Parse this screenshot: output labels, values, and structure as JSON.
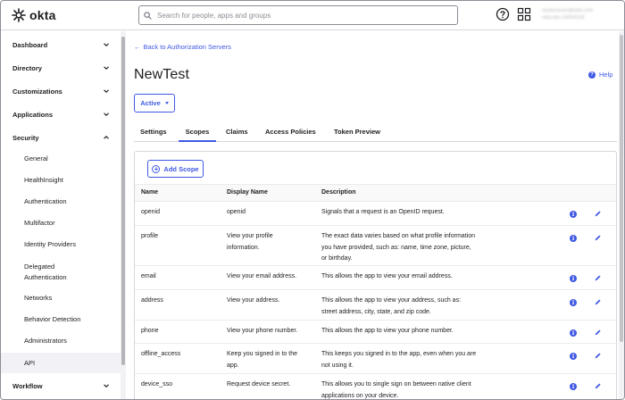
{
  "topbar": {
    "logo_text": "okta",
    "search_placeholder": "Search for people, apps and groups",
    "user_email": "randomuser@okta.com",
    "user_org": "okta-dev-19054128"
  },
  "sidebar": {
    "top_items": [
      {
        "label": "Dashboard",
        "expanded": false
      },
      {
        "label": "Directory",
        "expanded": false
      },
      {
        "label": "Customizations",
        "expanded": false
      },
      {
        "label": "Applications",
        "expanded": false
      },
      {
        "label": "Security",
        "expanded": true
      },
      {
        "label": "Workflow",
        "expanded": false
      }
    ],
    "security_items": [
      {
        "label": "General"
      },
      {
        "label": "HealthInsight"
      },
      {
        "label": "Authentication"
      },
      {
        "label": "Multifactor"
      },
      {
        "label": "Identity Providers"
      },
      {
        "label": "Delegated",
        "label2": "Authentication"
      },
      {
        "label": "Networks"
      },
      {
        "label": "Behavior Detection"
      },
      {
        "label": "Administrators"
      },
      {
        "label": "API",
        "active": true
      }
    ]
  },
  "main": {
    "back_link": "Back to Authorization Servers",
    "title": "NewTest",
    "help": "Help",
    "status": "Active",
    "tabs": [
      "Settings",
      "Scopes",
      "Claims",
      "Access Policies",
      "Token Preview"
    ],
    "active_tab": "Scopes",
    "add_scope_label": "Add Scope",
    "table": {
      "headers": [
        "Name",
        "Display Name",
        "Description"
      ],
      "rows": [
        {
          "name": "openid",
          "display": [
            "openid"
          ],
          "desc": [
            "Signals that a request is an OpenID request."
          ]
        },
        {
          "name": "profile",
          "display": [
            "View your profile",
            "information."
          ],
          "desc": [
            "The exact data varies based on what profile information",
            "you have provided, such as: name, time zone, picture,",
            "or birthday."
          ]
        },
        {
          "name": "email",
          "display": [
            "View your email address."
          ],
          "desc": [
            "This allows the app to view your email address."
          ]
        },
        {
          "name": "address",
          "display": [
            "View your address."
          ],
          "desc": [
            "This allows the app to view your address, such as:",
            "street address, city, state, and zip code."
          ]
        },
        {
          "name": "phone",
          "display": [
            "View your phone number."
          ],
          "desc": [
            "This allows the app to view your phone number."
          ]
        },
        {
          "name": "offline_access",
          "display": [
            "Keep you signed in to the",
            "app."
          ],
          "desc": [
            "This keeps you signed in to the app, even when you are",
            "not using it."
          ]
        },
        {
          "name": "device_sso",
          "display": [
            "Request device secret."
          ],
          "desc": [
            "This allows you to single sign on between native client",
            "applications on your device."
          ]
        }
      ]
    }
  },
  "colors": {
    "accent": "#3f59e4",
    "text": "#1d1d21",
    "border": "#d7d7dc"
  },
  "icons": {
    "logo": "okta-sunburst-icon",
    "search": "search-icon",
    "help": "question-circle-icon",
    "apps": "app-grid-icon",
    "info": "info-icon",
    "edit": "pencil-icon"
  }
}
